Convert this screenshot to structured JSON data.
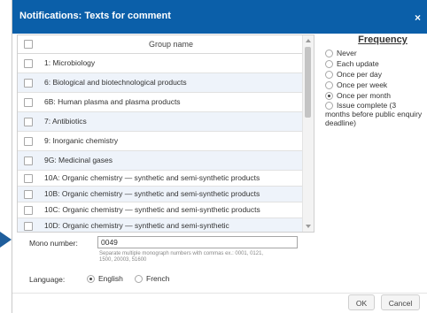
{
  "dialog": {
    "title": "Notifications: Texts for comment",
    "close_glyph": "×"
  },
  "groups": {
    "column_header": "Group name",
    "rows": [
      "1: Microbiology",
      "6: Biological and biotechnological products",
      "6B: Human plasma and plasma products",
      "7: Antibiotics",
      "9: Inorganic chemistry",
      "9G: Medicinal gases",
      "10A: Organic chemistry — synthetic and semi-synthetic products",
      "10B: Organic chemistry — synthetic and semi-synthetic products",
      "10C: Organic chemistry — synthetic and semi-synthetic products",
      "10D: Organic chemistry — synthetic and semi-synthetic"
    ]
  },
  "frequency": {
    "heading": "Frequency",
    "options": [
      {
        "label": "Never",
        "checked": false
      },
      {
        "label": "Each update",
        "checked": false
      },
      {
        "label": "Once per day",
        "checked": false
      },
      {
        "label": "Once per week",
        "checked": false
      },
      {
        "label": "Once per month",
        "checked": true
      },
      {
        "label": "Issue complete (3 months before public enquiry deadline)",
        "checked": false
      }
    ]
  },
  "mono": {
    "label": "Mono number:",
    "value": "0049",
    "hint": "Separate multiple monograph numbers with commas ex.: 0001, 0121, 1500, 20003, 51600"
  },
  "language": {
    "label": "Language:",
    "options": [
      {
        "label": "English",
        "checked": true
      },
      {
        "label": "French",
        "checked": false
      }
    ]
  },
  "buttons": {
    "ok": "OK",
    "cancel": "Cancel"
  },
  "colors": {
    "titlebar": "#0b5fa9",
    "row_alt": "#eef3fa",
    "arrow": "#1f5e9c"
  }
}
